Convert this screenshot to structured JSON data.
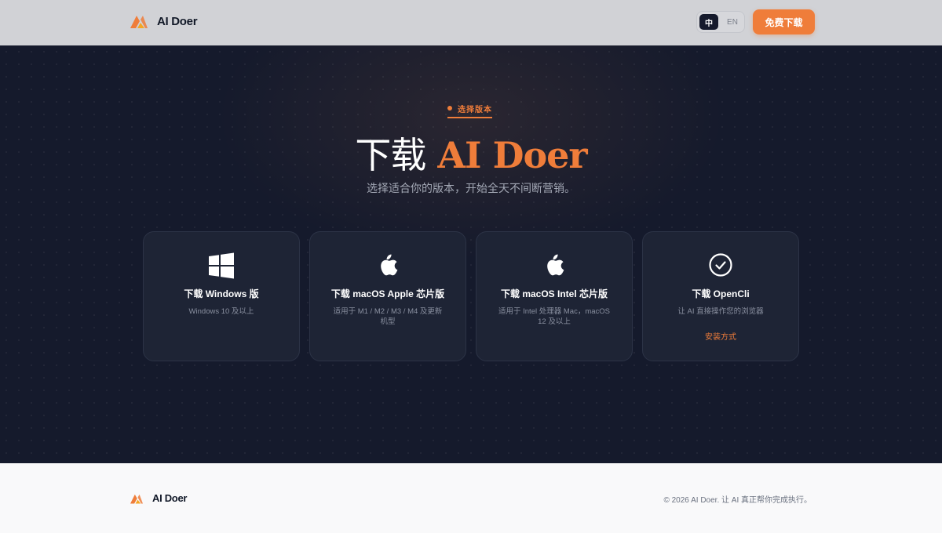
{
  "header": {
    "brand": "AI Doer",
    "lang_options": [
      "中",
      "EN"
    ],
    "active_lang": "中",
    "cta_label": "免费下载"
  },
  "hero": {
    "eyebrow": "选择版本",
    "title_prefix": "下载",
    "title_highlight": "AI Doer",
    "subtitle": "选择适合你的版本，开始全天不间断营销。"
  },
  "cards": [
    {
      "icon": "windows-icon",
      "title": "下载 Windows 版",
      "desc": "Windows 10 及以上",
      "link": ""
    },
    {
      "icon": "apple-icon",
      "title": "下载 macOS Apple 芯片版",
      "desc": "适用于 M1 / M2 / M3 / M4 及更新机型",
      "link": ""
    },
    {
      "icon": "apple-icon",
      "title": "下载 macOS Intel 芯片版",
      "desc": "适用于 Intel 处理器 Mac，macOS 12 及以上",
      "link": ""
    },
    {
      "icon": "check-circle-icon",
      "title": "下载 OpenCli",
      "desc": "让 AI 直接操作您的浏览器",
      "link": "安装方式"
    }
  ],
  "footer": {
    "brand": "AI Doer",
    "copyright": "© 2026 AI Doer. 让 AI 真正帮你完成执行。"
  },
  "colors": {
    "accent": "#ef7d3a",
    "hero_bg": "#151a2c",
    "header_bg": "#d1d2d6"
  }
}
